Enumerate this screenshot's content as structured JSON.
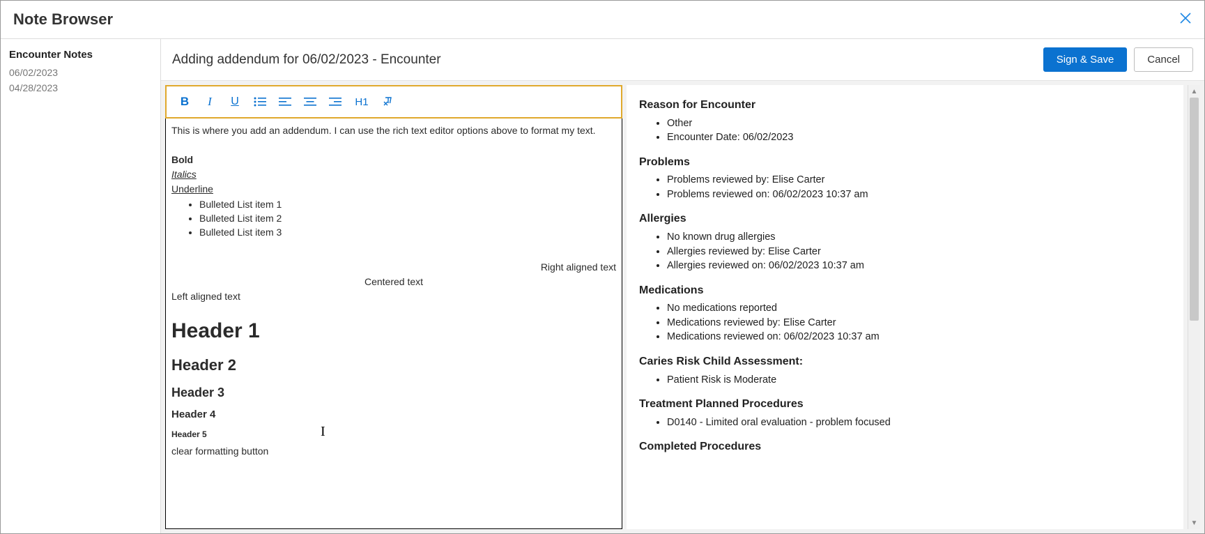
{
  "window": {
    "title": "Note Browser"
  },
  "sidebar": {
    "heading": "Encounter Notes",
    "dates": [
      "06/02/2023",
      "04/28/2023"
    ]
  },
  "header": {
    "title": "Adding addendum for 06/02/2023 - Encounter",
    "sign_save": "Sign & Save",
    "cancel": "Cancel"
  },
  "toolbar": {
    "h1_label": "H1"
  },
  "editor": {
    "intro": "This is where you add an addendum. I can use the rich text editor options above to format my text.",
    "bold": "Bold",
    "italic": "Italics",
    "underline": "Underline",
    "bullets": [
      "Bulleted List item 1",
      "Bulleted List item 2",
      "Bulleted List item 3"
    ],
    "right_aligned": "Right aligned text",
    "centered": "Centered text",
    "left_aligned": "Left aligned text",
    "h1": "Header 1",
    "h2": "Header 2",
    "h3": "Header 3",
    "h4": "Header 4",
    "h5": "Header 5",
    "clear_fmt": "clear formatting button"
  },
  "detail": {
    "reason_heading": "Reason for Encounter",
    "reason_items": [
      "Other",
      "Encounter Date: 06/02/2023"
    ],
    "problems_heading": "Problems",
    "problems_items": [
      "Problems reviewed by: Elise Carter",
      "Problems reviewed on: 06/02/2023 10:37 am"
    ],
    "allergies_heading": "Allergies",
    "allergies_items": [
      "No known drug allergies",
      "Allergies reviewed by: Elise Carter",
      "Allergies reviewed on: 06/02/2023 10:37 am"
    ],
    "medications_heading": "Medications",
    "medications_items": [
      "No medications reported",
      "Medications reviewed by: Elise Carter",
      "Medications reviewed on: 06/02/2023 10:37 am"
    ],
    "caries_heading": "Caries Risk Child Assessment:",
    "caries_items": [
      "Patient Risk is Moderate"
    ],
    "planned_heading": "Treatment Planned Procedures",
    "planned_items": [
      "D0140 - Limited oral evaluation - problem focused"
    ],
    "completed_heading": "Completed Procedures"
  }
}
